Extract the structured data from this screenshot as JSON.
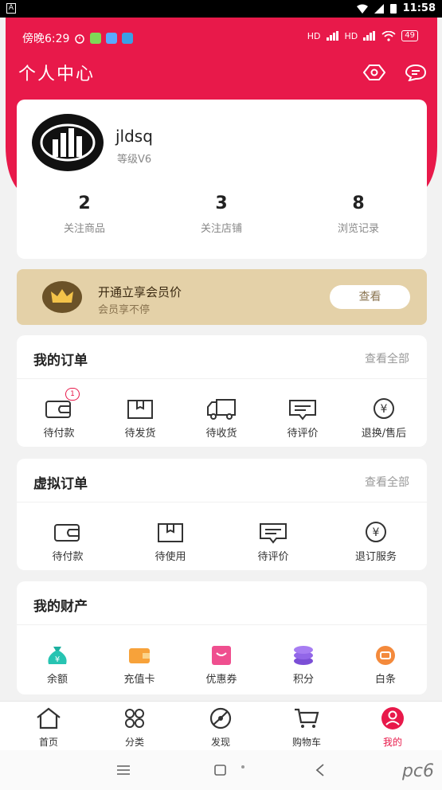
{
  "os_status": {
    "time": "11:58",
    "a_label": "A"
  },
  "in_status": {
    "time": "傍晚6:29",
    "signal1": "HD",
    "signal2": "HD",
    "battery": "49"
  },
  "header": {
    "title": "个人中心"
  },
  "profile": {
    "username": "jldsq",
    "level": "等级V6",
    "stats": [
      {
        "num": "2",
        "label": "关注商品"
      },
      {
        "num": "3",
        "label": "关注店铺"
      },
      {
        "num": "8",
        "label": "浏览记录"
      }
    ]
  },
  "vip": {
    "title": "开通立享会员价",
    "subtitle": "会员享不停",
    "button": "查看"
  },
  "orders": {
    "title": "我的订单",
    "more": "查看全部",
    "items": [
      {
        "label": "待付款",
        "icon": "wallet-icon",
        "badge": "1"
      },
      {
        "label": "待发货",
        "icon": "box-icon"
      },
      {
        "label": "待收货",
        "icon": "truck-icon"
      },
      {
        "label": "待评价",
        "icon": "comment-icon"
      },
      {
        "label": "退换/售后",
        "icon": "yuan-icon"
      }
    ]
  },
  "virtual_orders": {
    "title": "虚拟订单",
    "more": "查看全部",
    "items": [
      {
        "label": "待付款",
        "icon": "wallet-icon"
      },
      {
        "label": "待使用",
        "icon": "box-icon"
      },
      {
        "label": "待评价",
        "icon": "comment-icon"
      },
      {
        "label": "退订服务",
        "icon": "yuan-icon"
      }
    ]
  },
  "assets": {
    "title": "我的财产",
    "items": [
      {
        "label": "余额",
        "icon": "money-bag-icon"
      },
      {
        "label": "充值卡",
        "icon": "card-wallet-icon"
      },
      {
        "label": "优惠券",
        "icon": "coupon-icon"
      },
      {
        "label": "积分",
        "icon": "points-stack-icon"
      },
      {
        "label": "白条",
        "icon": "credit-icon"
      }
    ]
  },
  "tabbar": [
    {
      "label": "首页",
      "icon": "home-icon"
    },
    {
      "label": "分类",
      "icon": "category-icon"
    },
    {
      "label": "发现",
      "icon": "discover-icon"
    },
    {
      "label": "购物车",
      "icon": "cart-icon"
    },
    {
      "label": "我的",
      "icon": "profile-icon"
    }
  ],
  "watermark": "pc6",
  "colors": {
    "brand": "#e8194a",
    "gold": "#e4d1a8",
    "text": "#222222",
    "muted": "#999999"
  }
}
